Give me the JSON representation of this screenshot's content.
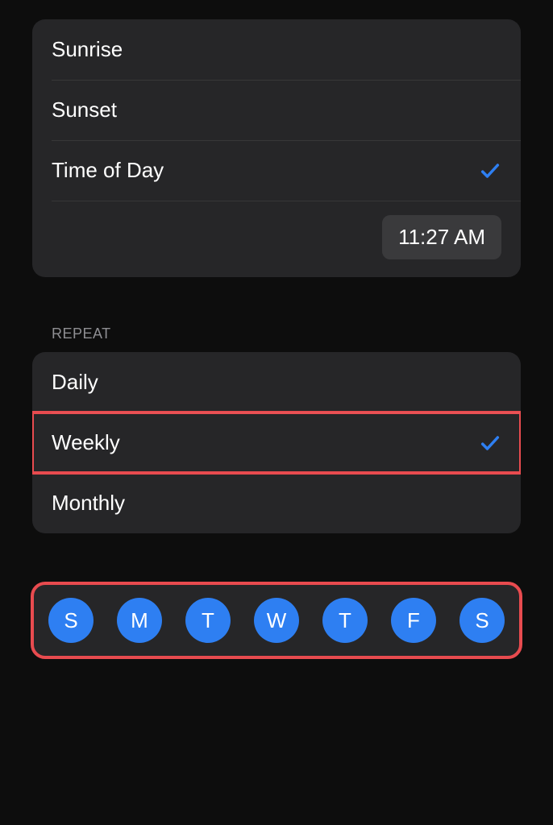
{
  "timeOptions": {
    "items": [
      {
        "label": "Sunrise",
        "selected": false
      },
      {
        "label": "Sunset",
        "selected": false
      },
      {
        "label": "Time of Day",
        "selected": true
      }
    ],
    "timeValue": "11:27 AM"
  },
  "repeat": {
    "header": "REPEAT",
    "items": [
      {
        "label": "Daily",
        "selected": false
      },
      {
        "label": "Weekly",
        "selected": true
      },
      {
        "label": "Monthly",
        "selected": false
      }
    ]
  },
  "days": {
    "items": [
      {
        "label": "S"
      },
      {
        "label": "M"
      },
      {
        "label": "T"
      },
      {
        "label": "W"
      },
      {
        "label": "T"
      },
      {
        "label": "F"
      },
      {
        "label": "S"
      }
    ]
  },
  "colors": {
    "accent": "#2e7ff2",
    "highlight": "#e84b4f"
  }
}
